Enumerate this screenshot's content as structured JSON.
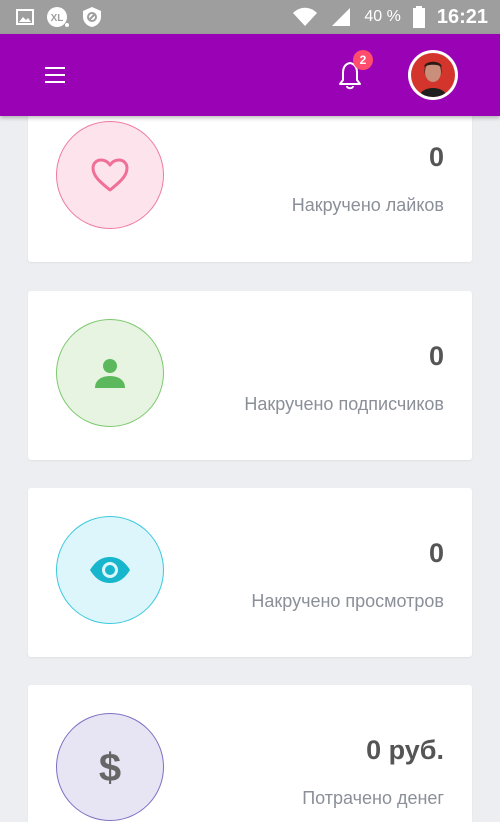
{
  "statusbar": {
    "battery_percent": "40 %",
    "time": "16:21",
    "icons": [
      "image-icon",
      "xl-icon",
      "shield-icon",
      "wifi-icon",
      "signal-icon",
      "battery-icon"
    ]
  },
  "appbar": {
    "notification_count": "2",
    "colors": {
      "background": "#9a03b5",
      "badge": "#ff4d6d"
    }
  },
  "cards": [
    {
      "value": "0",
      "label": "Накручено лайков",
      "icon": "heart-icon",
      "circle_bg": "#fde4ec",
      "circle_border": "#ef7aa0",
      "icon_color": "#ef6f97"
    },
    {
      "value": "0",
      "label": "Накручено подписчиков",
      "icon": "user-icon",
      "circle_bg": "#e6f4e1",
      "circle_border": "#7cc96f",
      "icon_color": "#5cb85c"
    },
    {
      "value": "0",
      "label": "Накручено просмотров",
      "icon": "eye-icon",
      "circle_bg": "#dcf6fb",
      "circle_border": "#3cc9dc",
      "icon_color": "#17b6cc"
    },
    {
      "value": "0 руб.",
      "label": "Потрачено денег",
      "icon": "dollar-icon",
      "circle_bg": "#e7e4f4",
      "circle_border": "#7e70c4",
      "icon_color": "#666666"
    }
  ]
}
